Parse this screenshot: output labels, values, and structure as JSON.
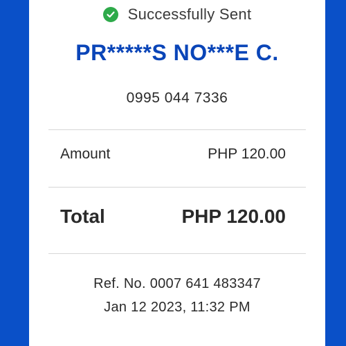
{
  "status": {
    "icon": "check-circle-icon",
    "text": "Successfully Sent",
    "icon_color": "#2eaa4a"
  },
  "recipient": {
    "name": "PR*****S NO***E C.",
    "number": "0995 044 7336"
  },
  "details": {
    "amount_label": "Amount",
    "amount_value": "PHP 120.00",
    "total_label": "Total",
    "total_value": "PHP 120.00"
  },
  "reference": {
    "ref_text": "Ref. No. 0007 641 483347",
    "datetime": "Jan 12 2023, 11:32 PM"
  },
  "colors": {
    "background": "#0a50c8",
    "accent": "#0a45b8",
    "card": "#ffffff"
  }
}
